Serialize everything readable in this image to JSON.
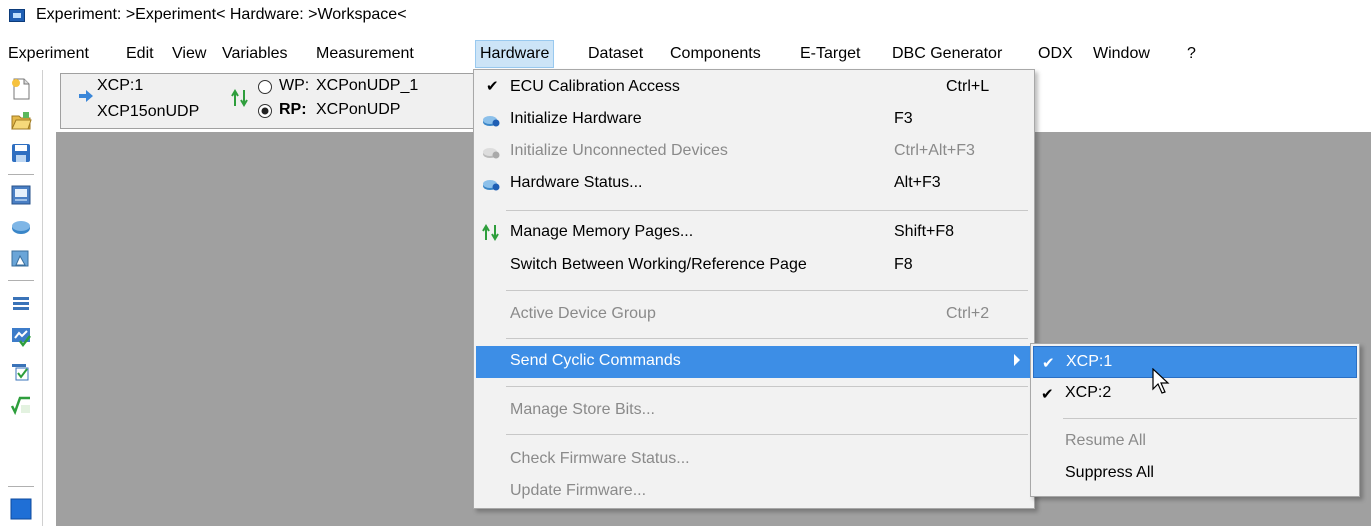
{
  "titlebar": {
    "title": "Experiment: >Experiment< Hardware: >Workspace<"
  },
  "menubar": {
    "items": [
      "Experiment",
      "Edit",
      "View",
      "Variables",
      "Measurement",
      "Hardware",
      "Dataset",
      "Components",
      "E-Target",
      "DBC Generator",
      "ODX",
      "Window",
      "?"
    ],
    "active": "Hardware"
  },
  "device_panel": {
    "device_name": "XCP:1",
    "device_protocol": "XCP15onUDP",
    "wp_label": "WP:",
    "wp_value": "XCPonUDP_1",
    "rp_label": "RP:",
    "rp_value": "XCPonUDP"
  },
  "hardware_menu": {
    "items": [
      {
        "label": "ECU Calibration Access",
        "shortcut": "Ctrl+L",
        "checked": true,
        "enabled": true
      },
      {
        "label": "Initialize Hardware",
        "shortcut": "F3",
        "icon": "hardware-init-icon",
        "enabled": true
      },
      {
        "label": "Initialize Unconnected Devices",
        "shortcut": "Ctrl+Alt+F3",
        "icon": "hardware-unconnected-icon",
        "enabled": false
      },
      {
        "label": "Hardware Status...",
        "shortcut": "Alt+F3",
        "icon": "hardware-status-icon",
        "enabled": true
      },
      {
        "label": "Manage Memory Pages...",
        "shortcut": "Shift+F8",
        "icon": "memory-pages-icon",
        "enabled": true
      },
      {
        "label": "Switch Between Working/Reference Page",
        "shortcut": "F8",
        "enabled": true
      },
      {
        "label": "Active Device Group",
        "shortcut": "Ctrl+2",
        "enabled": false
      },
      {
        "label": "Send Cyclic Commands",
        "shortcut": "",
        "enabled": true,
        "highlighted": true,
        "has_submenu": true
      },
      {
        "label": "Manage Store Bits...",
        "shortcut": "",
        "enabled": false
      },
      {
        "label": "Check Firmware Status...",
        "shortcut": "",
        "enabled": false
      },
      {
        "label": "Update Firmware...",
        "shortcut": "",
        "enabled": false
      }
    ]
  },
  "cyclic_submenu": {
    "items": [
      {
        "label": "XCP:1",
        "checked": true,
        "highlighted": true,
        "enabled": true
      },
      {
        "label": "XCP:2",
        "checked": true,
        "enabled": true
      },
      {
        "label": "Resume All",
        "enabled": false
      },
      {
        "label": "Suppress All",
        "enabled": true
      }
    ]
  },
  "colors": {
    "highlight": "#3d8ee6",
    "workspace": "#a0a0a0",
    "menu_bg": "#f2f2f2"
  }
}
